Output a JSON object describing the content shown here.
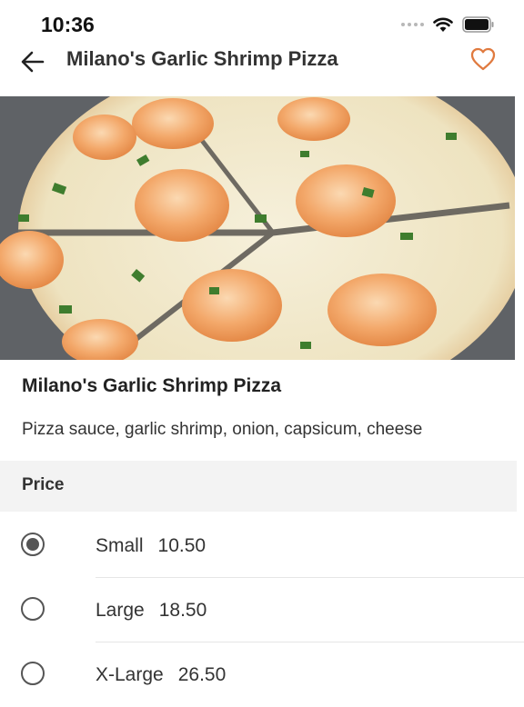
{
  "status_bar": {
    "time": "10:36"
  },
  "nav": {
    "title": "Milano's Garlic Shrimp Pizza"
  },
  "item": {
    "title": "Milano's Garlic Shrimp Pizza",
    "description": "Pizza sauce, garlic shrimp, onion, capsicum, cheese"
  },
  "price_section": {
    "header": "Price",
    "options": [
      {
        "size": "Small",
        "price": "10.50",
        "selected": true
      },
      {
        "size": "Large",
        "price": "18.50",
        "selected": false
      },
      {
        "size": "X-Large",
        "price": "26.50",
        "selected": false
      }
    ]
  },
  "colors": {
    "accent": "#e07a3f",
    "text": "#222222",
    "section_bg": "#f3f3f3"
  },
  "icons": {
    "back": "arrow-left-icon",
    "favorite": "heart-outline-icon",
    "wifi": "wifi-icon",
    "battery": "battery-icon"
  }
}
